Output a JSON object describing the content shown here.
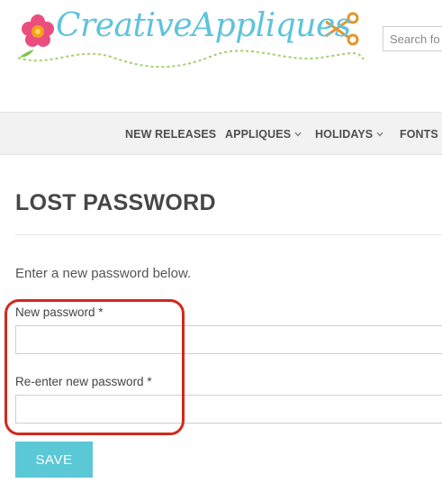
{
  "header": {
    "logo_text": "CreativeAppliques",
    "search_placeholder": "Search fo"
  },
  "nav": {
    "items": [
      {
        "label": "NEW RELEASES",
        "has_dropdown": false
      },
      {
        "label": "APPLIQUES",
        "has_dropdown": true
      },
      {
        "label": "HOLIDAYS",
        "has_dropdown": true
      },
      {
        "label": "FONTS",
        "has_dropdown": false
      }
    ]
  },
  "main": {
    "title": "LOST PASSWORD",
    "intro": "Enter a new password below.",
    "new_password_label": "New password *",
    "confirm_password_label": "Re-enter new password *",
    "save_label": "SAVE"
  },
  "colors": {
    "accent": "#5bc8d6",
    "annotation_outline": "#d2291c",
    "logo_text": "#5fc3dc"
  }
}
